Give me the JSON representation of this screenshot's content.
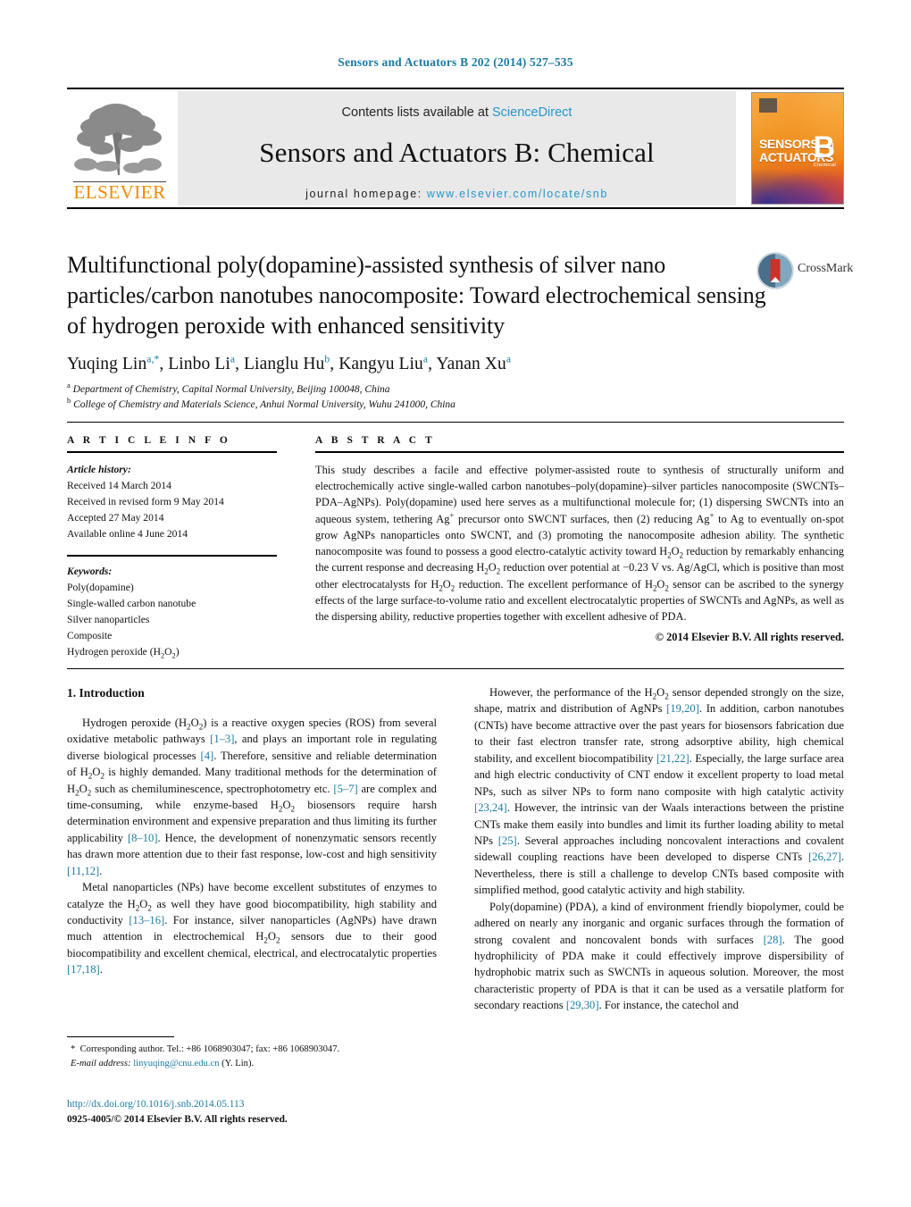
{
  "running_head": "Sensors and Actuators B 202 (2014) 527–535",
  "banner": {
    "contents_prefix": "Contents lists available at ",
    "contents_link": "ScienceDirect",
    "journal_title": "Sensors and Actuators B: Chemical",
    "homepage_prefix": "journal homepage: ",
    "homepage_url": "www.elsevier.com/locate/snb",
    "publisher_logo_text": "ELSEVIER",
    "cover": {
      "line1": "SENSORS",
      "line1_small": "and",
      "line2": "ACTUATORS",
      "letter": "B",
      "sub": "Chemical"
    },
    "link_color": "#2596cd"
  },
  "article": {
    "title": "Multifunctional poly(dopamine)-assisted synthesis of silver nano particles/carbon nanotubes nanocomposite: Toward electrochemical sensing of hydrogen peroxide with enhanced sensitivity",
    "crossmark_label": "CrossMark",
    "authors_html": "Yuqing Lin<sup>a,*</sup>, Linbo Li<sup>a</sup>, Lianglu Hu<sup>b</sup>, Kangyu Liu<sup>a</sup>, Yanan Xu<sup>a</sup>",
    "affiliations": [
      "a Department of Chemistry, Capital Normal University, Beijing 100048, China",
      "b College of Chemistry and Materials Science, Anhui Normal University, Wuhu 241000, China"
    ]
  },
  "info": {
    "heading": "A R T I C L E    I N F O",
    "history_label": "Article history:",
    "history": [
      "Received 14 March 2014",
      "Received in revised form 9 May 2014",
      "Accepted 27 May 2014",
      "Available online 4 June 2014"
    ],
    "keywords_label": "Keywords:",
    "keywords_html": [
      "Poly(dopamine)",
      "Single-walled carbon nanotube",
      "Silver nanoparticles",
      "Composite",
      "Hydrogen peroxide (H<sub>2</sub>O<sub>2</sub>)"
    ]
  },
  "abstract": {
    "heading": "A B S T R A C T",
    "body_html": "This study describes a facile and effective polymer-assisted route to synthesis of structurally uniform and electrochemically active single-walled carbon nanotubes–poly(dopamine)–silver particles nanocomposite (SWCNTs–PDA–AgNPs). Poly(dopamine) used here serves as a multifunctional molecule for; (1) dispersing SWCNTs into an aqueous system, tethering Ag<sup>+</sup> precursor onto SWCNT surfaces, then (2) reducing Ag<sup>+</sup> to Ag to eventually on-spot grow AgNPs nanoparticles onto SWCNT, and (3) promoting the nanocomposite adhesion ability. The synthetic nanocomposite was found to possess a good electro-catalytic activity toward H<sub>2</sub>O<sub>2</sub> reduction by remarkably enhancing the current response and decreasing H<sub>2</sub>O<sub>2</sub> reduction over potential at −0.23 V vs. Ag/AgCl, which is positive than most other electrocatalysts for H<sub>2</sub>O<sub>2</sub> reduction. The excellent performance of H<sub>2</sub>O<sub>2</sub> sensor can be ascribed to the synergy effects of the large surface-to-volume ratio and excellent electrocatalytic properties of SWCNTs and AgNPs, as well as the dispersing ability, reductive properties together with excellent adhesive of PDA.",
    "copyright": "© 2014 Elsevier B.V. All rights reserved."
  },
  "sections": {
    "intro_heading": "1.  Introduction",
    "left_paragraphs_html": [
      "Hydrogen peroxide (H<sub>2</sub>O<sub>2</sub>) is a reactive oxygen species (ROS) from several oxidative metabolic pathways <a class=\"ref\">[1–3]</a>, and plays an important role in regulating diverse biological processes <a class=\"ref\">[4]</a>. Therefore, sensitive and reliable determination of H<sub>2</sub>O<sub>2</sub> is highly demanded. Many traditional methods for the determination of H<sub>2</sub>O<sub>2</sub> such as chemiluminescence, spectrophotometry etc. <a class=\"ref\">[5–7]</a> are complex and time-consuming, while enzyme-based H<sub>2</sub>O<sub>2</sub> biosensors require harsh determination environment and expensive preparation and thus limiting its further applicability <a class=\"ref\">[8–10]</a>. Hence, the development of nonenzymatic sensors recently has drawn more attention due to their fast response, low-cost and high sensitivity <a class=\"ref\">[11,12]</a>.",
      "Metal nanoparticles (NPs) have become excellent substitutes of enzymes to catalyze the H<sub>2</sub>O<sub>2</sub> as well they have good biocompatibility, high stability and conductivity <a class=\"ref\">[13–16]</a>. For instance, silver nanoparticles (AgNPs) have drawn much attention in electrochemical H<sub>2</sub>O<sub>2</sub> sensors due to their good biocompatibility and excellent chemical, electrical, and electrocatalytic properties <a class=\"ref\">[17,18]</a>."
    ],
    "right_paragraphs_html": [
      "However, the performance of the H<sub>2</sub>O<sub>2</sub> sensor depended strongly on the size, shape, matrix and distribution of AgNPs <a class=\"ref\">[19,20]</a>. In addition, carbon nanotubes (CNTs) have become attractive over the past years for biosensors fabrication due to their fast electron transfer rate, strong adsorptive ability, high chemical stability, and excellent biocompatibility <a class=\"ref\">[21,22]</a>. Especially, the large surface area and high electric conductivity of CNT endow it excellent property to load metal NPs, such as silver NPs to form nano composite with high catalytic activity <a class=\"ref\">[23,24]</a>. However, the intrinsic van der Waals interactions between the pristine CNTs make them easily into bundles and limit its further loading ability to metal NPs <a class=\"ref\">[25]</a>. Several approaches including noncovalent interactions and covalent sidewall coupling reactions have been developed to disperse CNTs <a class=\"ref\">[26,27]</a>. Nevertheless, there is still a challenge to develop CNTs based composite with simplified method, good catalytic activity and high stability.",
      "Poly(dopamine) (PDA), a kind of environment friendly biopolymer, could be adhered on nearly any inorganic and organic surfaces through the formation of strong covalent and noncovalent bonds with surfaces <a class=\"ref\">[28]</a>. The good hydrophilicity of PDA make it could effectively improve dispersibility of hydrophobic matrix such as SWCNTs in aqueous solution. Moreover, the most characteristic property of PDA is that it can be used as a versatile platform for secondary reactions <a class=\"ref\">[29,30]</a>. For instance, the catechol and"
    ]
  },
  "footer": {
    "corresponding_html": "* &nbsp;Corresponding author. Tel.: +86 1068903047; fax: +86 1068903047.",
    "email_label": "E-mail address:",
    "email": "linyuqing@cnu.edu.cn",
    "email_suffix": " (Y. Lin).",
    "doi": "http://dx.doi.org/10.1016/j.snb.2014.05.113",
    "issn_line": "0925-4005/© 2014 Elsevier B.V. All rights reserved."
  }
}
